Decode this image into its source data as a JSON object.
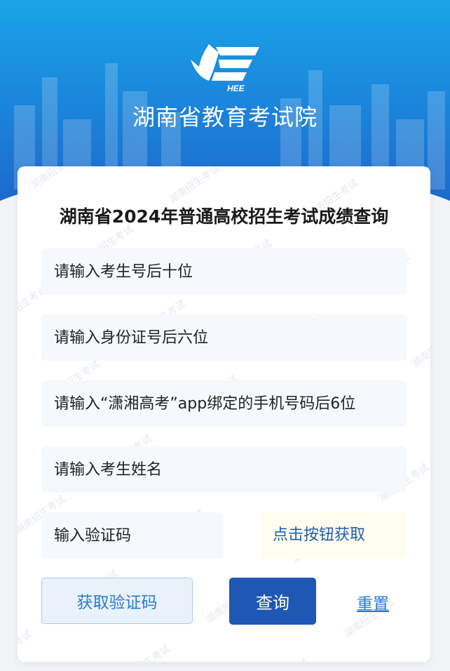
{
  "header": {
    "logo_text": "HEE",
    "org_name": "湖南省教育考试院"
  },
  "form": {
    "title": "湖南省2024年普通高校招生考试成绩查询",
    "watermark_text": "湖南招生考试",
    "exam_no_placeholder": "请输入考生号后十位",
    "id_card_placeholder": "请输入身份证号后六位",
    "phone_placeholder": "请输入“潇湘高考”app绑定的手机号码后6位",
    "name_placeholder": "请输入考生姓名",
    "captcha_placeholder": "输入验证码",
    "captcha_hint": "点击按钮获取",
    "get_captcha_label": "获取验证码",
    "query_label": "查询",
    "reset_label": "重置"
  },
  "colors": {
    "header_top": "#1aa3e6",
    "header_bottom": "#1d63c8",
    "primary_button": "#1f57b5",
    "link": "#2b7bd0",
    "field_bg": "#f5f8fd",
    "hint_bg": "#fffdef"
  }
}
